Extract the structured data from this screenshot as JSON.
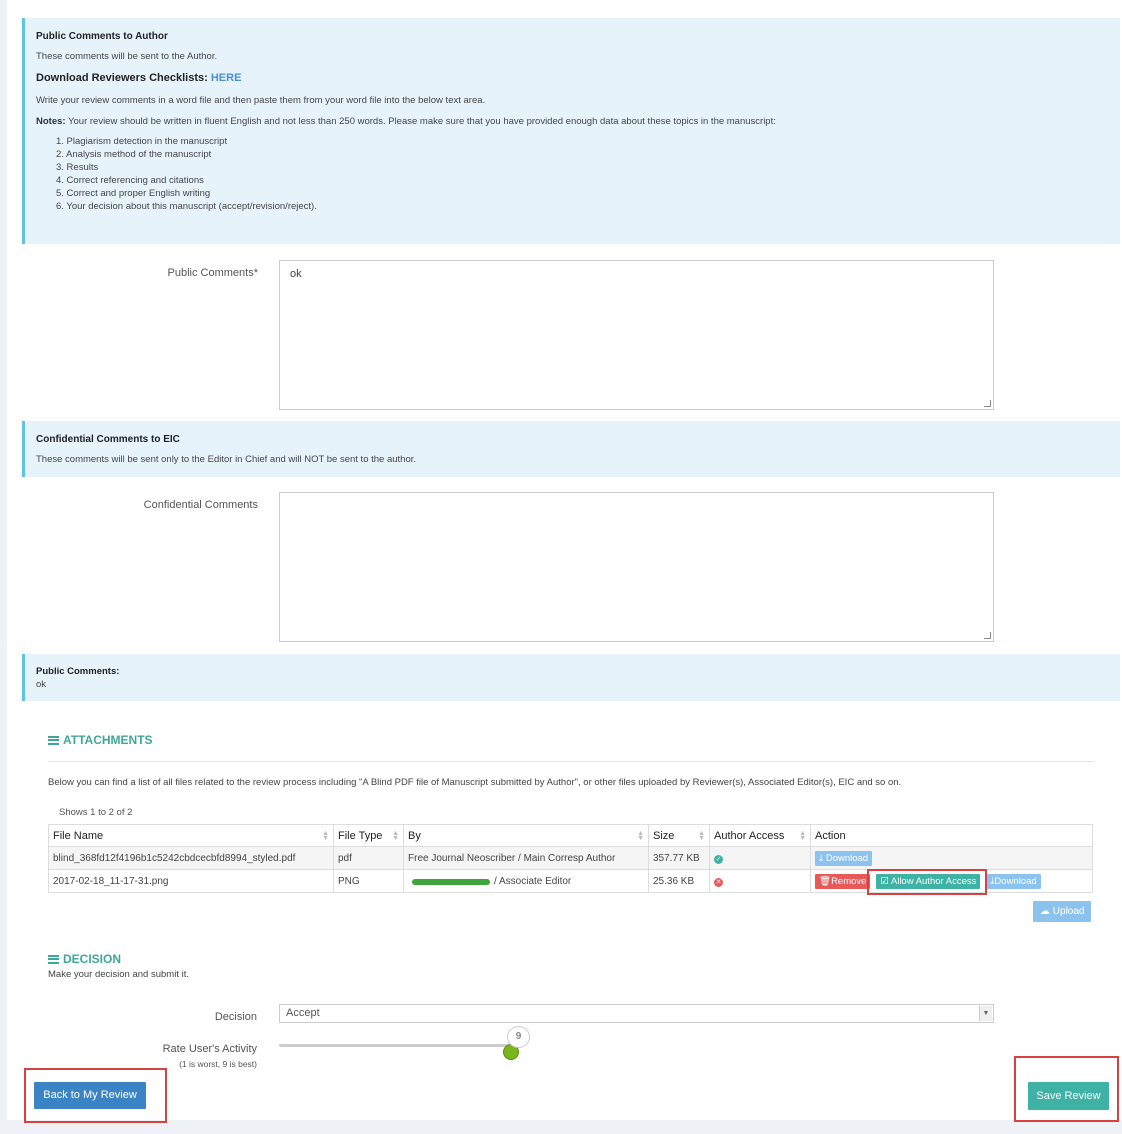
{
  "public_note": {
    "title": "Public Comments to Author",
    "line1": "These comments will be sent to the Author.",
    "checklist_prefix": "Download Reviewers Checklists:",
    "checklist_link": "HERE",
    "line2": "Write your review comments in a word file and then paste them from your word file into the below text area.",
    "notes_label": "Notes:",
    "notes_text": "Your review should be written in fluent English and not less than 250 words. Please make sure that you have provided enough data about these topics in the manuscript:",
    "items": [
      "1. Plagiarism detection in the manuscript",
      "2. Analysis method of the manuscript",
      "3. Results",
      "4. Correct referencing and citations",
      "5. Correct and proper English writing",
      "6. Your decision about this manuscript (accept/revision/reject)."
    ]
  },
  "public_comments": {
    "label": "Public Comments",
    "required_mark": "*",
    "value": "ok"
  },
  "confidential_note": {
    "title": "Confidential Comments to EIC",
    "text": "These comments will be sent only to the Editor in Chief and will NOT be sent to the author."
  },
  "confidential_comments": {
    "label": "Confidential Comments",
    "value": ""
  },
  "summary": {
    "title": "Public Comments:",
    "value": "ok"
  },
  "attachments": {
    "title": "ATTACHMENTS",
    "description": "Below you can find a list of all files related to the review process including \"A Blind PDF file of Manuscript submitted by Author\", or other files uploaded by Reviewer(s), Associated Editor(s), EIC and so on.",
    "shows": "Shows 1 to 2 of 2",
    "columns": [
      "File Name",
      "File Type",
      "By",
      "Size",
      "Author Access",
      "Action"
    ],
    "rows": [
      {
        "file": "blind_368fd12f4196b1c5242cbdcecbfd8994_styled.pdf",
        "type": "pdf",
        "by": "Free Journal Neoscriber / Main Corresp Author",
        "size": "357.77 KB",
        "access": "yes"
      },
      {
        "file": "2017-02-18_11-17-31.png",
        "type": "PNG",
        "by": "/ Associate Editor",
        "size": "25.36 KB",
        "access": "no"
      }
    ],
    "btn_download": "Download",
    "btn_remove": "Remove",
    "btn_allow": "Allow Author Access",
    "btn_upload": "Upload"
  },
  "decision": {
    "title": "DECISION",
    "subtitle": "Make your decision and submit it.",
    "decision_label": "Decision",
    "decision_value": "Accept",
    "rate_label": "Rate User's Activity",
    "rate_hint": "(1 is worst, 9 is best)",
    "rate_value": "9"
  },
  "footer": {
    "back_label": "Back to My Review",
    "save_label": "Save Review"
  },
  "colors": {
    "accent": "#3ea79a",
    "info_bg": "#e7f3fa",
    "info_border": "#62c3e0",
    "primary": "#3a84c6",
    "danger": "#e85a5a",
    "highlight": "#d9403f"
  }
}
